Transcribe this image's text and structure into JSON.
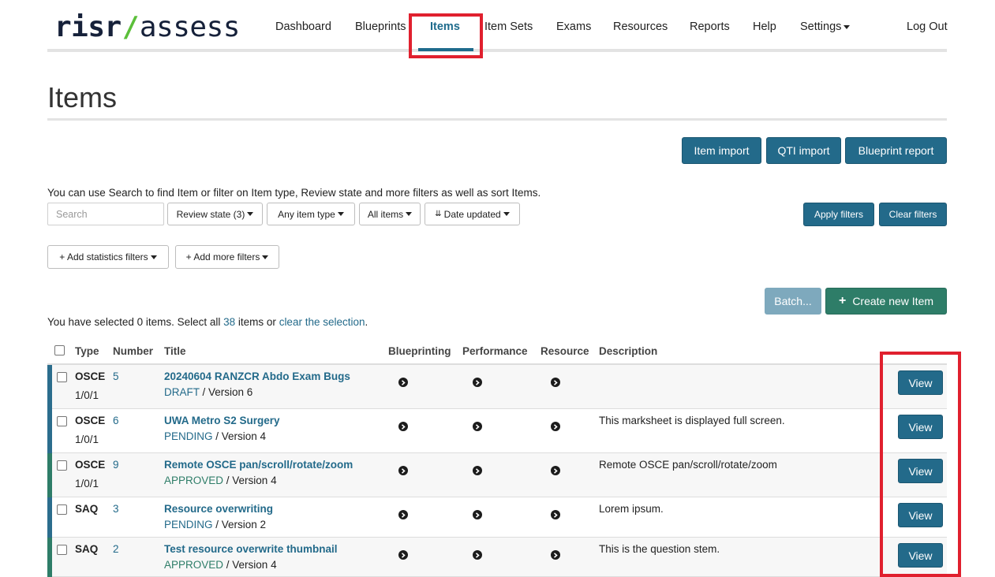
{
  "brand": {
    "part1": "risr",
    "slash": "/",
    "part2": "assess"
  },
  "nav": {
    "dashboard": "Dashboard",
    "blueprints": "Blueprints",
    "items": "Items",
    "item_sets": "Item Sets",
    "exams": "Exams",
    "resources": "Resources",
    "reports": "Reports",
    "help": "Help",
    "settings": "Settings",
    "logout": "Log Out"
  },
  "page": {
    "title": "Items"
  },
  "toolbar": {
    "item_import": "Item import",
    "qti_import": "QTI import",
    "blueprint_report": "Blueprint report"
  },
  "filters": {
    "help_text": "You can use Search to find Item or filter on Item type, Review state and more filters as well as sort Items.",
    "search_placeholder": "Search",
    "review_state": "Review state (3)",
    "item_type": "Any item type",
    "all_items": "All items",
    "date_updated": "Date updated",
    "apply": "Apply filters",
    "clear": "Clear filters",
    "add_statistics": "+ Add statistics filters",
    "add_more": "+ Add more filters"
  },
  "actions": {
    "batch": "Batch...",
    "create": "Create new Item"
  },
  "selection": {
    "prefix": "You have selected 0 items. Select all ",
    "count": "38",
    "middle": " items or ",
    "clear_link": "clear the selection",
    "suffix": "."
  },
  "table": {
    "headers": {
      "type": "Type",
      "number": "Number",
      "title": "Title",
      "blueprinting": "Blueprinting",
      "performance": "Performance",
      "resource": "Resource",
      "description": "Description"
    },
    "view_label": "View",
    "rows": [
      {
        "type": "OSCE",
        "type_sub": "1/0/1",
        "number": "5",
        "title": "20240604 RANZCR Abdo Exam Bugs",
        "status": "DRAFT",
        "version": " / Version 6",
        "description": ""
      },
      {
        "type": "OSCE",
        "type_sub": "1/0/1",
        "number": "6",
        "title": "UWA Metro S2 Surgery",
        "status": "PENDING",
        "version": " / Version 4",
        "description": "This marksheet is displayed full screen."
      },
      {
        "type": "OSCE",
        "type_sub": "1/0/1",
        "number": "9",
        "title": "Remote OSCE pan/scroll/rotate/zoom",
        "status": "APPROVED",
        "version": " / Version 4",
        "description": "Remote OSCE pan/scroll/rotate/zoom"
      },
      {
        "type": "SAQ",
        "type_sub": "",
        "number": "3",
        "title": "Resource overwriting",
        "status": "PENDING",
        "version": " / Version 2",
        "description": "Lorem ipsum."
      },
      {
        "type": "SAQ",
        "type_sub": "",
        "number": "2",
        "title": "Test resource overwrite thumbnail",
        "status": "APPROVED",
        "version": " / Version 4",
        "description": "This is the question stem."
      }
    ]
  },
  "colors": {
    "primary": "#236a8a",
    "success": "#2e7d68",
    "highlight": "#e0202e",
    "accent_osce": "#2b6d8d",
    "accent_saq": "#2e7d68"
  }
}
